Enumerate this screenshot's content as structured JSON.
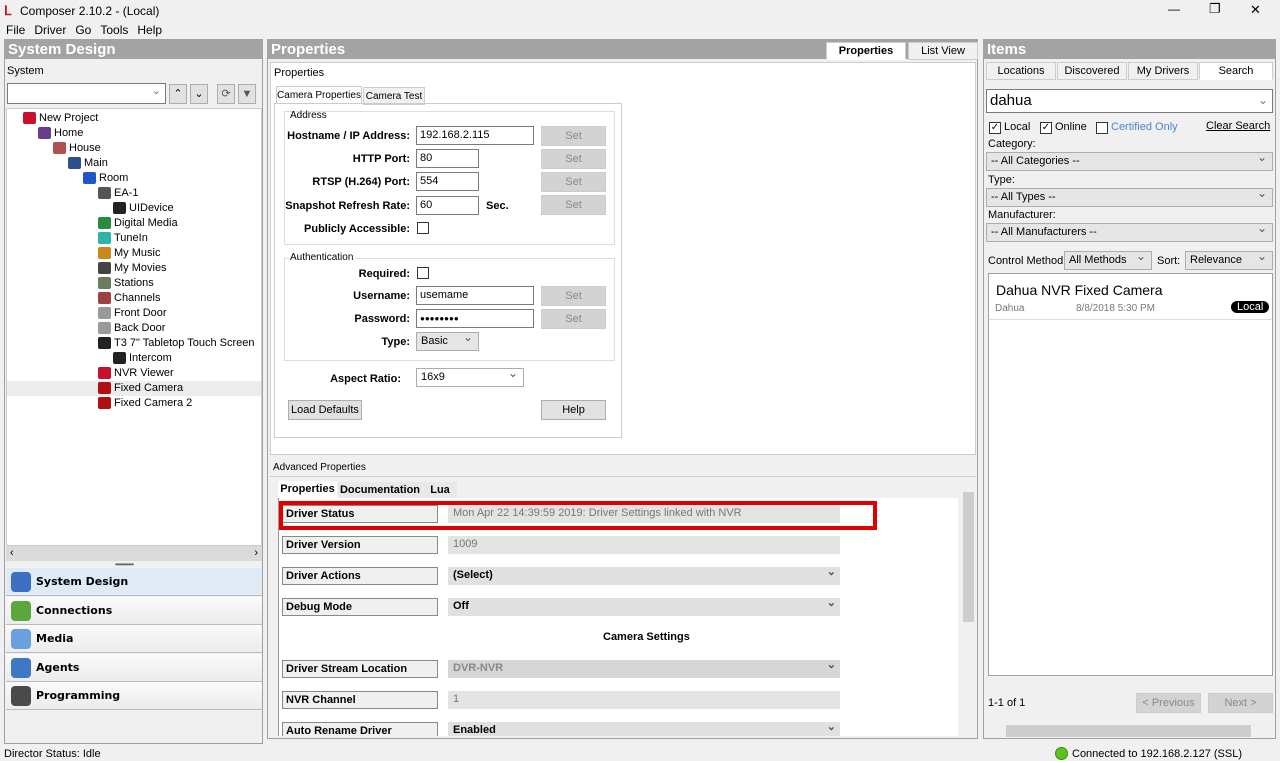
{
  "window": {
    "title": "Composer 2.10.2 - (Local)",
    "minimize": "—",
    "restore": "❐",
    "close": "✕"
  },
  "menu": [
    "File",
    "Driver",
    "Go",
    "Tools",
    "Help"
  ],
  "left": {
    "header": "System Design",
    "section": "System",
    "tree": [
      {
        "label": "New Project",
        "level": 0,
        "icon": "control4-logo-icon",
        "color": "#c8102e"
      },
      {
        "label": "Home",
        "level": 1,
        "icon": "home-icon",
        "color": "#6a3b8a"
      },
      {
        "label": "House",
        "level": 2,
        "icon": "house-icon",
        "color": "#b05050"
      },
      {
        "label": "Main",
        "level": 3,
        "icon": "floor-icon",
        "color": "#2d4f8a"
      },
      {
        "label": "Room",
        "level": 4,
        "icon": "room-shield-icon",
        "color": "#1f56c8"
      },
      {
        "label": "EA-1",
        "level": 5,
        "icon": "controller-icon",
        "color": "#555"
      },
      {
        "label": "UIDevice",
        "level": 6,
        "icon": "ui-device-icon",
        "color": "#222"
      },
      {
        "label": "Digital Media",
        "level": 5,
        "icon": "digital-media-icon",
        "color": "#2b8a3e"
      },
      {
        "label": "TuneIn",
        "level": 5,
        "icon": "tunein-icon",
        "color": "#2bb5a8"
      },
      {
        "label": "My Music",
        "level": 5,
        "icon": "music-icon",
        "color": "#c98a1a"
      },
      {
        "label": "My Movies",
        "level": 5,
        "icon": "movies-icon",
        "color": "#444"
      },
      {
        "label": "Stations",
        "level": 5,
        "icon": "stations-icon",
        "color": "#6a7d5e"
      },
      {
        "label": "Channels",
        "level": 5,
        "icon": "channels-icon",
        "color": "#a04040"
      },
      {
        "label": "Front Door",
        "level": 5,
        "icon": "camera-icon",
        "color": "#999"
      },
      {
        "label": "Back Door",
        "level": 5,
        "icon": "camera-icon",
        "color": "#999"
      },
      {
        "label": "T3 7\" Tabletop Touch Screen",
        "level": 5,
        "icon": "touchscreen-icon",
        "color": "#222"
      },
      {
        "label": "Intercom",
        "level": 6,
        "icon": "intercom-icon",
        "color": "#222"
      },
      {
        "label": "NVR Viewer",
        "level": 5,
        "icon": "control4-logo-icon",
        "color": "#c8102e"
      },
      {
        "label": "Fixed Camera",
        "level": 5,
        "icon": "axis-camera-icon",
        "color": "#b01010",
        "selected": true
      },
      {
        "label": "Fixed Camera 2",
        "level": 5,
        "icon": "axis-camera-icon",
        "color": "#b01010"
      }
    ],
    "nav": [
      {
        "label": "System Design",
        "icon": "system-design-icon",
        "color": "#3d6fc4",
        "active": true
      },
      {
        "label": "Connections",
        "icon": "connections-icon",
        "color": "#5aa83c"
      },
      {
        "label": "Media",
        "icon": "media-disc-icon",
        "color": "#6aa0e0"
      },
      {
        "label": "Agents",
        "icon": "agents-icon",
        "color": "#3d78c4"
      },
      {
        "label": "Programming",
        "icon": "traffic-light-icon",
        "color": "#4a4a4a"
      }
    ]
  },
  "middle": {
    "header": "Properties",
    "view_tabs": [
      "Properties",
      "List View"
    ],
    "group": "Properties",
    "tabs": [
      "Camera Properties",
      "Camera Test"
    ],
    "address": {
      "legend": "Address",
      "hostname_label": "Hostname / IP Address:",
      "hostname": "192.168.2.115",
      "http_label": "HTTP Port:",
      "http": "80",
      "rtsp_label": "RTSP (H.264) Port:",
      "rtsp": "554",
      "snapshot_label": "Snapshot Refresh Rate:",
      "snapshot": "60",
      "snapshot_unit": "Sec.",
      "public_label": "Publicly Accessible:",
      "public": false,
      "set": "Set"
    },
    "auth": {
      "legend": "Authentication",
      "required_label": "Required:",
      "required": false,
      "username_label": "Username:",
      "username": "usemame",
      "password_label": "Password:",
      "password": "●●●●●●●●",
      "type_label": "Type:",
      "type": "Basic"
    },
    "aspect_label": "Aspect Ratio:",
    "aspect": "16x9",
    "load_defaults": "Load Defaults",
    "help": "Help",
    "advanced": {
      "label": "Advanced Properties",
      "tabs": [
        "Properties",
        "Documentation",
        "Lua"
      ],
      "rows": [
        {
          "key": "Driver Status",
          "value": "Mon Apr 22 14:39:59 2019: Driver Settings linked with NVR",
          "kind": "text",
          "highlight": true
        },
        {
          "key": "Driver Version",
          "value": "1009",
          "kind": "text"
        },
        {
          "key": "Driver Actions",
          "value": "(Select)",
          "kind": "select"
        },
        {
          "key": "Debug Mode",
          "value": "Off",
          "kind": "select"
        },
        {
          "section": "Camera Settings"
        },
        {
          "key": "Driver Stream Location",
          "value": "DVR-NVR",
          "kind": "disabled-select"
        },
        {
          "key": "NVR Channel",
          "value": "1",
          "kind": "text"
        },
        {
          "key": "Auto Rename Driver",
          "value": "Enabled",
          "kind": "select"
        }
      ],
      "highlight_color": "#e00000"
    }
  },
  "right": {
    "header": "Items",
    "tabs": [
      "Locations",
      "Discovered",
      "My Drivers",
      "Search"
    ],
    "active_tab": "Search",
    "search": "dahua",
    "local_label": "Local",
    "local": true,
    "online_label": "Online",
    "online": true,
    "certified_label": "Certified Only",
    "certified": false,
    "clear": "Clear Search",
    "category_label": "Category:",
    "category": "-- All Categories --",
    "type_label": "Type:",
    "type": "-- All Types --",
    "manufacturer_label": "Manufacturer:",
    "manufacturer": "-- All Manufacturers --",
    "control_label": "Control Method:",
    "control": "All Methods",
    "sort_label": "Sort:",
    "sort": "Relevance",
    "result": {
      "title": "Dahua NVR Fixed Camera",
      "maker": "Dahua",
      "date": "8/8/2018 5:30 PM",
      "badge": "Local"
    },
    "count": "1-1 of 1",
    "prev": "< Previous",
    "next": "Next >"
  },
  "status": {
    "left": "Director Status: Idle",
    "right": "Connected to 192.168.2.127 (SSL)",
    "connected_color": "#5ec21e"
  }
}
